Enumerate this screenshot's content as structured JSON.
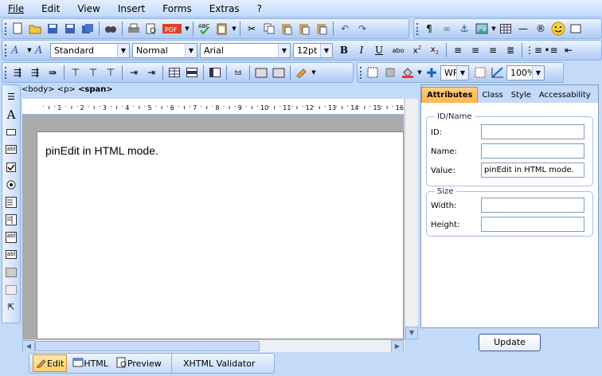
{
  "menu": [
    "File",
    "Edit",
    "View",
    "Insert",
    "Forms",
    "Extras",
    "?"
  ],
  "format_toolbar": {
    "style": "Standard",
    "block": "Normal",
    "font": "Arial",
    "size": "12pt",
    "bold": "B",
    "italic": "I",
    "underline": "U",
    "abbr": "abo"
  },
  "toolbar3": {
    "units": "WP",
    "zoom": "100%"
  },
  "breadcrumb": {
    "body": "<body>",
    "p": "<p>",
    "span": "<span>"
  },
  "ruler_numbers": [
    "1",
    "2",
    "3",
    "4",
    "5",
    "6",
    "7",
    "8",
    "9",
    "10",
    "11",
    "12",
    "13",
    "14",
    "15",
    "16"
  ],
  "editor": {
    "content": "pinEdit in HTML mode."
  },
  "mode_tabs": [
    {
      "label": "Edit",
      "icon": "edit-icon"
    },
    {
      "label": "HTML",
      "icon": "html-icon"
    },
    {
      "label": "Preview",
      "icon": "preview-icon"
    }
  ],
  "validator_label": "XHTML Validator",
  "panel": {
    "tabs": [
      "Attributes",
      "Class",
      "Style",
      "Accessability"
    ],
    "group_id": "ID/Name",
    "id_label": "ID:",
    "id_value": "",
    "name_label": "Name:",
    "name_value": "",
    "value_label": "Value:",
    "value_value": "pinEdit in HTML mode.",
    "group_size": "Size",
    "width_label": "Width:",
    "width_value": "",
    "height_label": "Height:",
    "height_value": "",
    "update": "Update"
  },
  "colors": {
    "accent": "#c3daf9",
    "active_tab": "#ffb44a"
  }
}
